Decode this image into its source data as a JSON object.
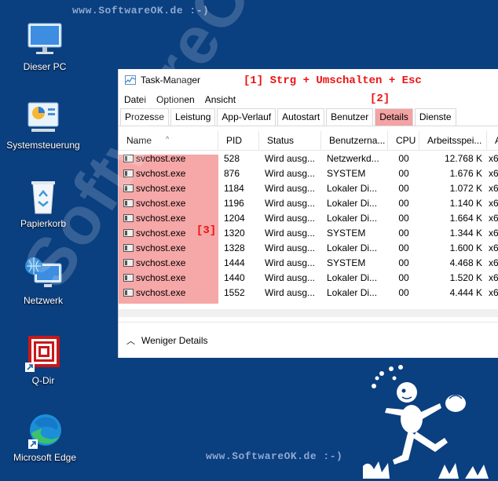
{
  "watermark": {
    "top": "www.SoftwareOK.de :-)",
    "bottom": "www.SoftwareOK.de :-)",
    "diagonal": "SoftwareOK.de"
  },
  "desktop_icons": [
    {
      "label": "Dieser PC",
      "icon": "monitor-icon"
    },
    {
      "label": "Systemsteuerung",
      "icon": "control-panel-icon"
    },
    {
      "label": "Papierkorb",
      "icon": "recycle-bin-icon"
    },
    {
      "label": "Netzwerk",
      "icon": "network-icon"
    },
    {
      "label": "Q-Dir",
      "icon": "qdir-icon"
    },
    {
      "label": "Microsoft Edge",
      "icon": "edge-icon"
    }
  ],
  "taskmanager": {
    "title": "Task-Manager",
    "annotation1": "[1] Strg + Umschalten + Esc",
    "annotation2": "[2]",
    "annotation3": "[3]",
    "menu": [
      "Datei",
      "Optionen",
      "Ansicht"
    ],
    "tabs": [
      "Prozesse",
      "Leistung",
      "App-Verlauf",
      "Autostart",
      "Benutzer",
      "Details",
      "Dienste"
    ],
    "active_tab": "Details",
    "columns": [
      "Name",
      "PID",
      "Status",
      "Benutzerna...",
      "CPU",
      "Arbeitsspei...",
      "Ar"
    ],
    "rows": [
      [
        "svchost.exe",
        "528",
        "Wird ausg...",
        "Netzwerkd...",
        "00",
        "12.768 K",
        "x6"
      ],
      [
        "svchost.exe",
        "876",
        "Wird ausg...",
        "SYSTEM",
        "00",
        "1.676 K",
        "x6"
      ],
      [
        "svchost.exe",
        "1184",
        "Wird ausg...",
        "Lokaler Di...",
        "00",
        "1.072 K",
        "x6"
      ],
      [
        "svchost.exe",
        "1196",
        "Wird ausg...",
        "Lokaler Di...",
        "00",
        "1.140 K",
        "x6"
      ],
      [
        "svchost.exe",
        "1204",
        "Wird ausg...",
        "Lokaler Di...",
        "00",
        "1.664 K",
        "x6"
      ],
      [
        "svchost.exe",
        "1320",
        "Wird ausg...",
        "SYSTEM",
        "00",
        "1.344 K",
        "x6"
      ],
      [
        "svchost.exe",
        "1328",
        "Wird ausg...",
        "Lokaler Di...",
        "00",
        "1.600 K",
        "x6"
      ],
      [
        "svchost.exe",
        "1444",
        "Wird ausg...",
        "SYSTEM",
        "00",
        "4.468 K",
        "x6"
      ],
      [
        "svchost.exe",
        "1440",
        "Wird ausg...",
        "Lokaler Di...",
        "00",
        "1.520 K",
        "x6"
      ],
      [
        "svchost.exe",
        "1552",
        "Wird ausg...",
        "Lokaler Di...",
        "00",
        "4.444 K",
        "x6"
      ]
    ],
    "footer_label": "Weniger Details"
  },
  "colors": {
    "desktop": "#0a3f80",
    "highlight": "#f6a7a7",
    "annotation": "#e11111"
  }
}
